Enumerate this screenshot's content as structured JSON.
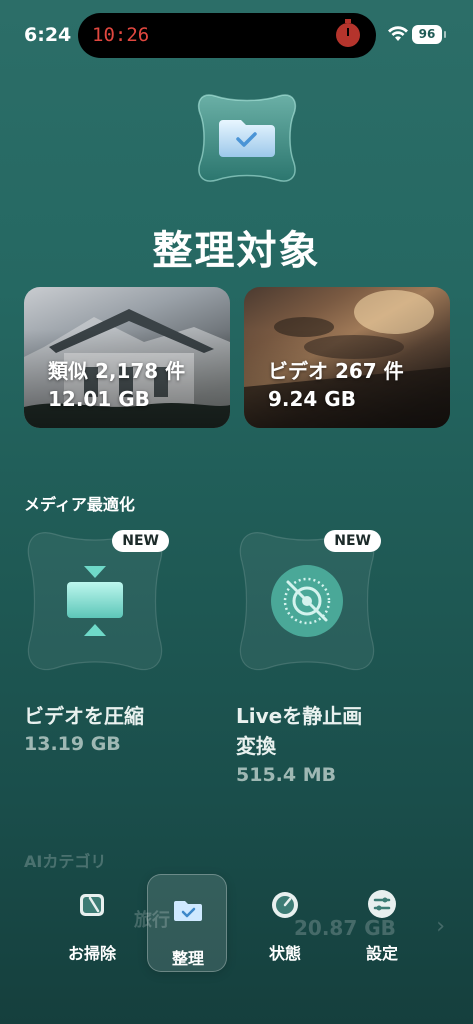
{
  "status_bar": {
    "time": "6:24",
    "island_clock": "10:26",
    "battery": "96"
  },
  "header": {
    "title": "整理対象"
  },
  "cards": [
    {
      "label": "類似 2,178 件",
      "size": "12.01 GB"
    },
    {
      "label": "ビデオ 267 件",
      "size": "9.24 GB"
    }
  ],
  "media_section": {
    "title": "メディア最適化",
    "items": [
      {
        "badge": "NEW",
        "name": "ビデオを圧縮",
        "name2": "",
        "size": "13.19 GB"
      },
      {
        "badge": "NEW",
        "name": "Liveを静止画",
        "name2": "変換",
        "size": "515.4 MB"
      }
    ]
  },
  "ai_section": {
    "title": "AIカテゴリ",
    "row_label": "旅行",
    "row_size": "20.87 GB"
  },
  "tabbar": {
    "tabs": [
      {
        "label": "お掃除",
        "icon": "clean-icon",
        "active": false
      },
      {
        "label": "整理",
        "icon": "folder-check-icon",
        "active": true
      },
      {
        "label": "状態",
        "icon": "gauge-icon",
        "active": false
      },
      {
        "label": "設定",
        "icon": "toggles-icon",
        "active": false
      }
    ]
  },
  "colors": {
    "background": "#1f5a55",
    "accent": "#5fd3c2",
    "badge_bg": "#ffffff"
  }
}
